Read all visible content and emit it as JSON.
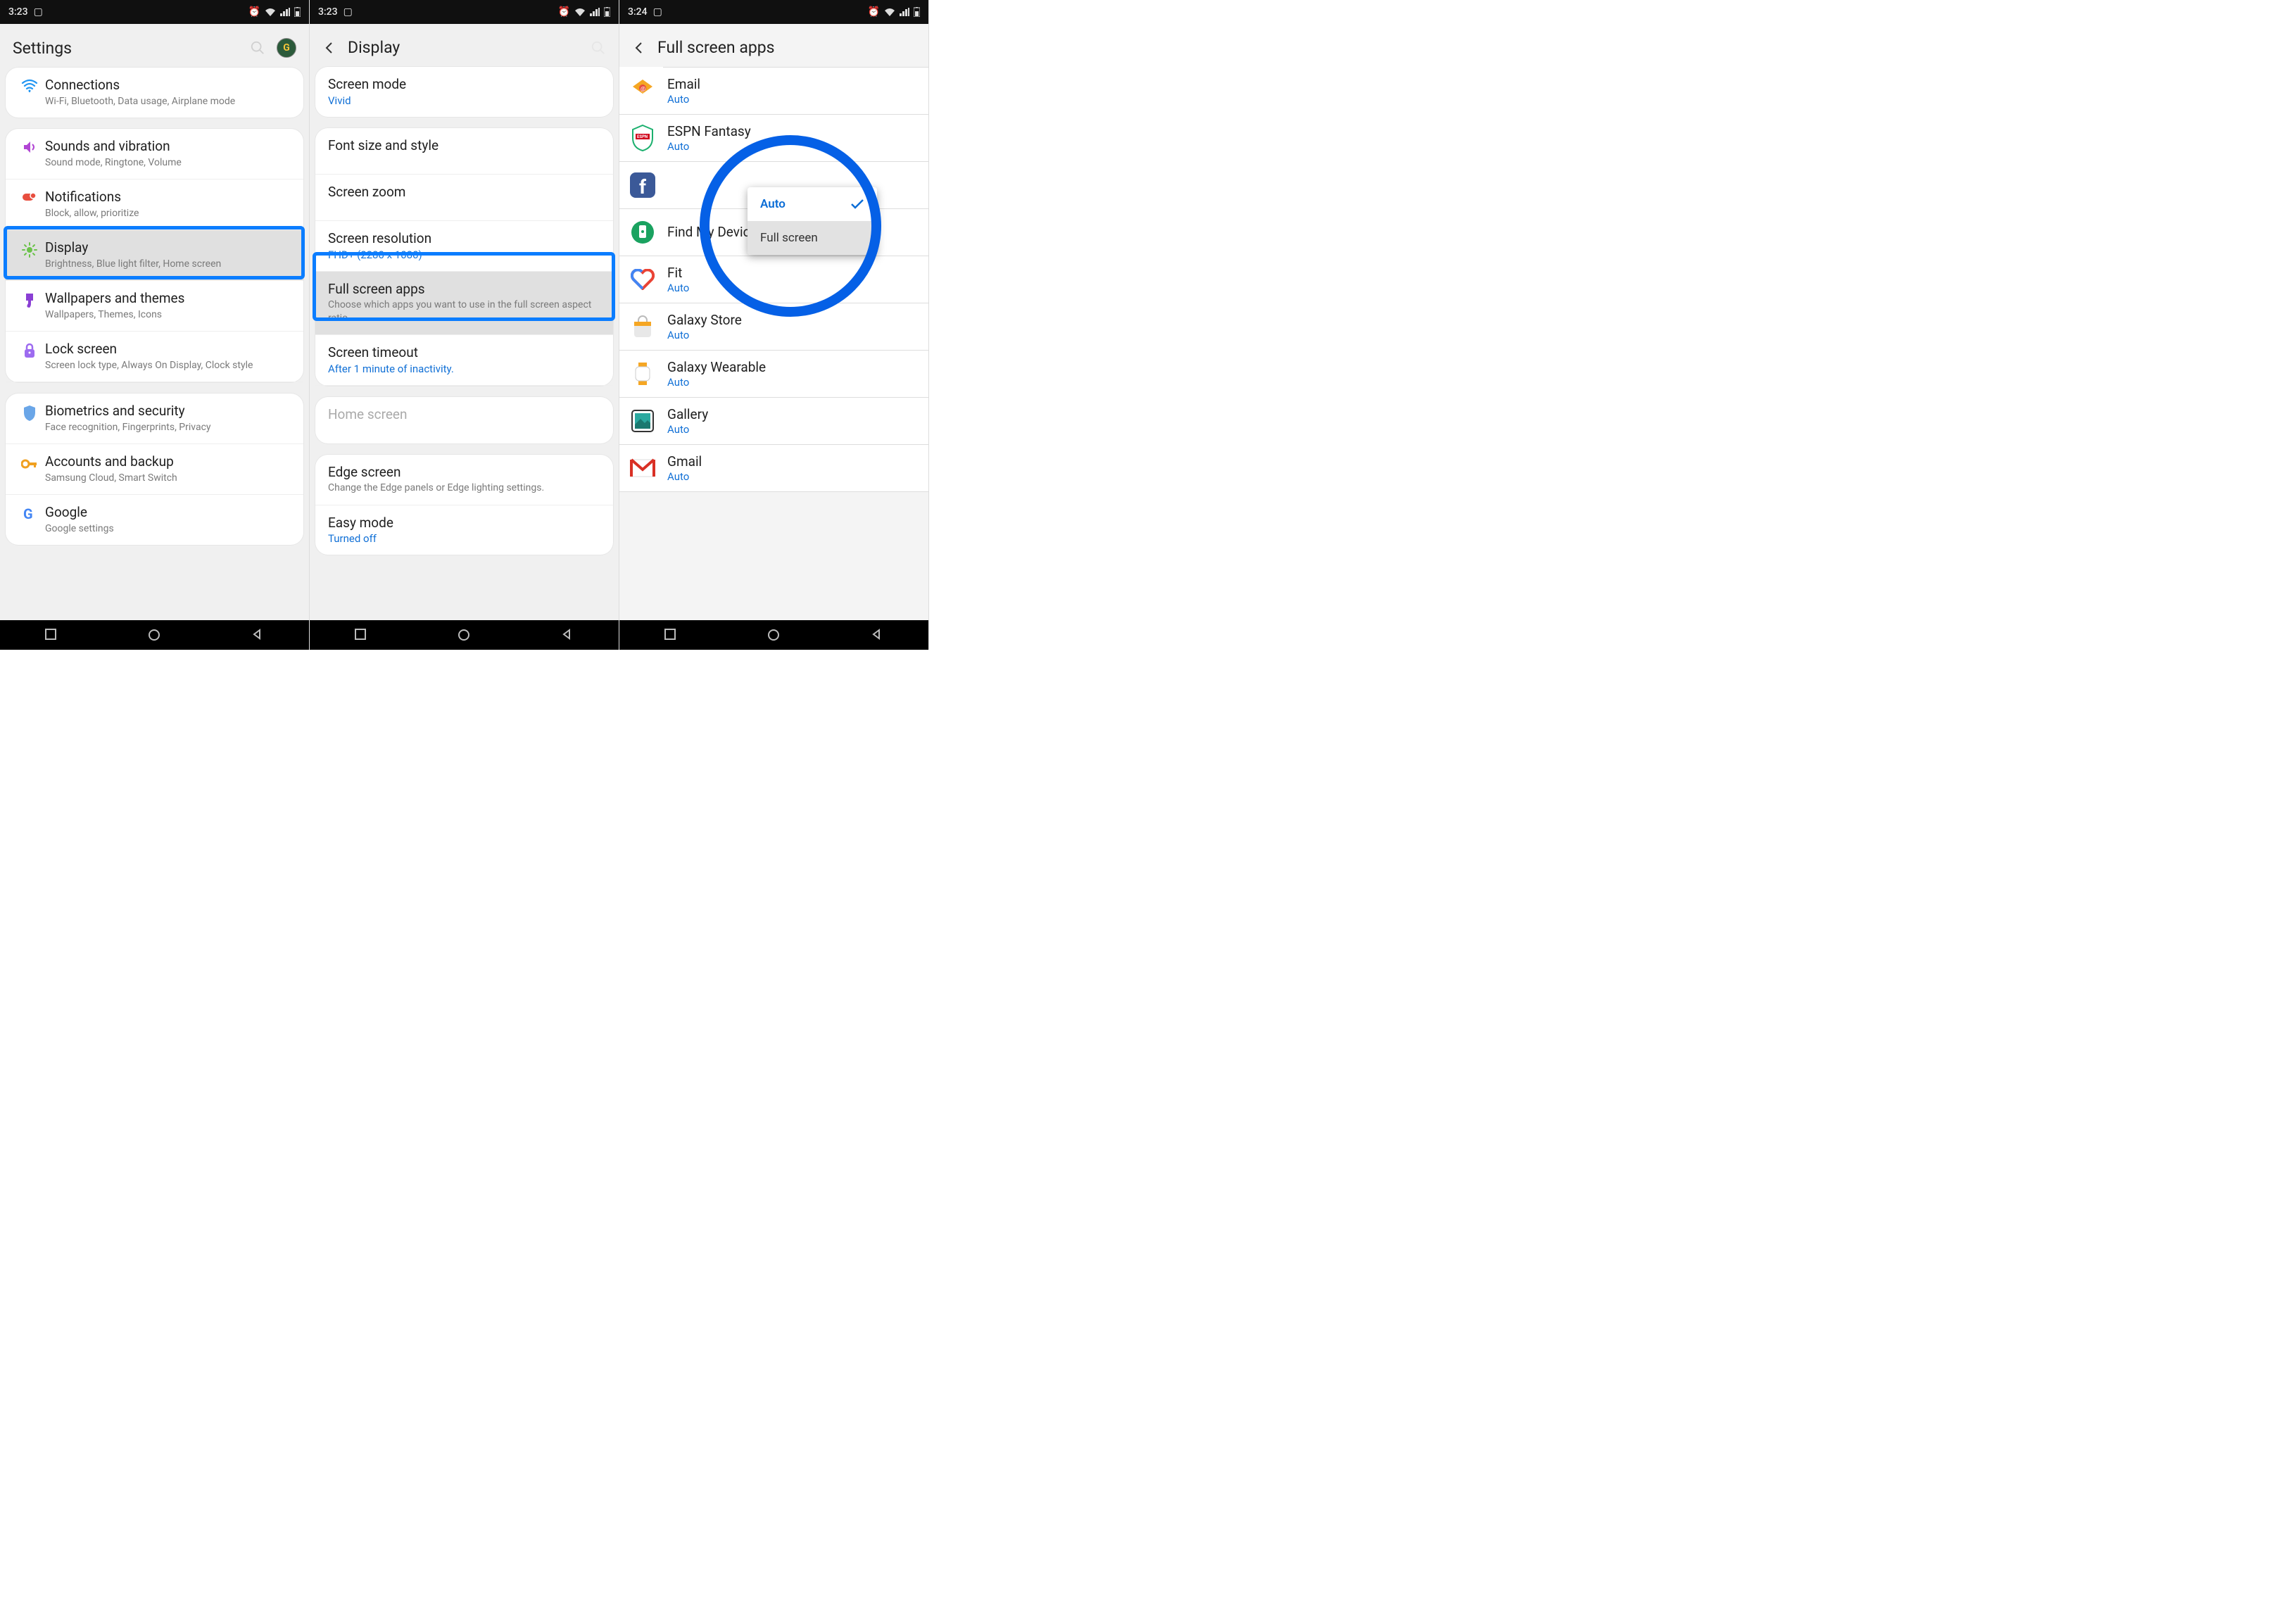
{
  "status": {
    "icons_label": "alarm wifi signal battery"
  },
  "nav": {
    "recent": "recent",
    "home": "home",
    "back": "back"
  },
  "phone1": {
    "time": "3:23",
    "title": "Settings",
    "groups": [
      {
        "items": [
          {
            "id": "connections",
            "label": "Connections",
            "sub": "Wi-Fi, Bluetooth, Data usage, Airplane mode",
            "icon": "wifi"
          }
        ]
      },
      {
        "items": [
          {
            "id": "sounds",
            "label": "Sounds and vibration",
            "sub": "Sound mode, Ringtone, Volume",
            "icon": "sound"
          },
          {
            "id": "notifications",
            "label": "Notifications",
            "sub": "Block, allow, prioritize",
            "icon": "notif"
          },
          {
            "id": "display",
            "label": "Display",
            "sub": "Brightness, Blue light filter, Home screen",
            "icon": "brightness",
            "hl": true
          },
          {
            "id": "wallpapers",
            "label": "Wallpapers and themes",
            "sub": "Wallpapers, Themes, Icons",
            "icon": "brush"
          },
          {
            "id": "lockscreen",
            "label": "Lock screen",
            "sub": "Screen lock type, Always On Display, Clock style",
            "icon": "lock"
          }
        ]
      },
      {
        "items": [
          {
            "id": "biometrics",
            "label": "Biometrics and security",
            "sub": "Face recognition, Fingerprints, Privacy",
            "icon": "shield"
          },
          {
            "id": "accounts",
            "label": "Accounts and backup",
            "sub": "Samsung Cloud, Smart Switch",
            "icon": "key"
          },
          {
            "id": "google",
            "label": "Google",
            "sub": "Google settings",
            "icon": "google"
          }
        ]
      }
    ]
  },
  "phone2": {
    "time": "3:23",
    "title": "Display",
    "groups": [
      {
        "items": [
          {
            "id": "screen-mode",
            "label": "Screen mode",
            "val": "Vivid"
          }
        ]
      },
      {
        "items": [
          {
            "id": "font",
            "label": "Font size and style"
          },
          {
            "id": "zoom",
            "label": "Screen zoom"
          },
          {
            "id": "resolution",
            "label": "Screen resolution",
            "val": "FHD+ (2280 x 1080)"
          },
          {
            "id": "fullscreen-apps",
            "label": "Full screen apps",
            "sub": "Choose which apps you want to use in the full screen aspect ratio.",
            "hl": true
          },
          {
            "id": "timeout",
            "label": "Screen timeout",
            "val": "After 1 minute of inactivity."
          }
        ]
      },
      {
        "items": [
          {
            "id": "home-screen",
            "label": "Home screen",
            "dim": true
          }
        ]
      },
      {
        "items": [
          {
            "id": "edge",
            "label": "Edge screen",
            "sub": "Change the Edge panels or Edge lighting settings."
          },
          {
            "id": "easy",
            "label": "Easy mode",
            "val": "Turned off"
          }
        ]
      }
    ]
  },
  "phone3": {
    "time": "3:24",
    "title": "Full screen apps",
    "apps": [
      {
        "id": "email",
        "label": "Email",
        "val": "Auto",
        "icon": "email"
      },
      {
        "id": "espn",
        "label": "ESPN Fantasy",
        "val": "Auto",
        "icon": "espn"
      },
      {
        "id": "facebook",
        "label": "",
        "val": "",
        "icon": "facebook"
      },
      {
        "id": "findmydevice",
        "label": "Find My Device",
        "val": "",
        "icon": "find"
      },
      {
        "id": "fit",
        "label": "Fit",
        "val": "Auto",
        "icon": "fit"
      },
      {
        "id": "galaxystore",
        "label": "Galaxy Store",
        "val": "Auto",
        "icon": "bag"
      },
      {
        "id": "galaxywearable",
        "label": "Galaxy Wearable",
        "val": "Auto",
        "icon": "watch"
      },
      {
        "id": "gallery",
        "label": "Gallery",
        "val": "Auto",
        "icon": "gallery"
      },
      {
        "id": "gmail",
        "label": "Gmail",
        "val": "Auto",
        "icon": "gmail"
      }
    ],
    "popup": {
      "opt1": "Auto",
      "opt2": "Full screen"
    }
  }
}
